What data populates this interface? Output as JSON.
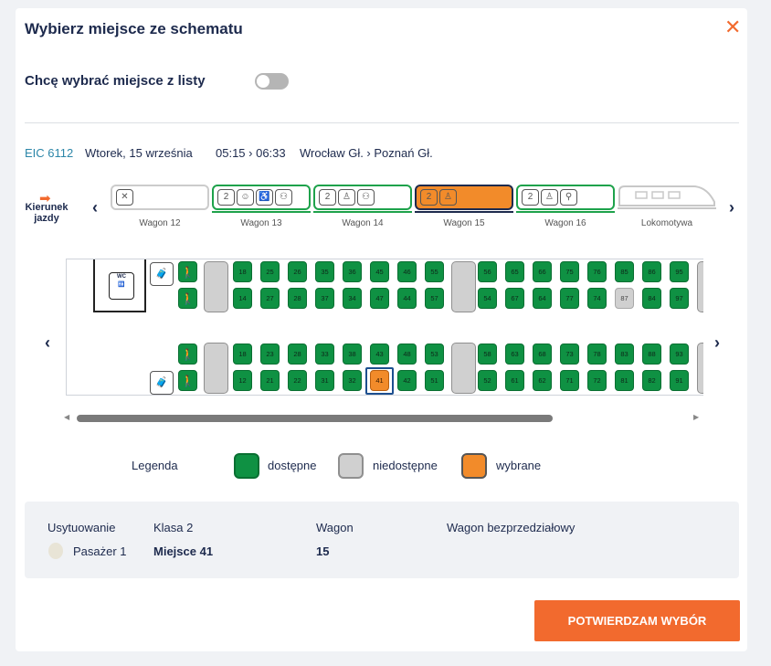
{
  "modal": {
    "title": "Wybierz miejsce ze schematu",
    "close_icon": "close-icon"
  },
  "toggle": {
    "label": "Chcę wybrać miejsce z listy",
    "state": "off"
  },
  "journey": {
    "train": "EIC 6112",
    "date": "Wtorek, 15 września",
    "time": "05:15 › 06:33",
    "route": "Wrocław Gł. › Poznań Gł."
  },
  "direction": {
    "label": "Kierunek jazdy"
  },
  "wagons": [
    {
      "label": "Wagon 12",
      "status": "unavailable",
      "icons": [
        "restaurant-icon"
      ]
    },
    {
      "label": "Wagon 13",
      "status": "available",
      "icons": [
        "class-2-icon",
        "child-icon",
        "wheelchair-icon",
        "carer-icon"
      ]
    },
    {
      "label": "Wagon 14",
      "status": "available",
      "icons": [
        "class-2-icon",
        "person-icon",
        "family-icon"
      ]
    },
    {
      "label": "Wagon 15",
      "status": "selected",
      "icons": [
        "class-2-icon",
        "person-icon"
      ]
    },
    {
      "label": "Wagon 16",
      "status": "available",
      "icons": [
        "class-2-icon",
        "person-icon",
        "bicycle-icon"
      ]
    },
    {
      "label": "Lokomotywa",
      "status": "locomotive",
      "icons": []
    }
  ],
  "seat_rows": {
    "top_window": [
      "18",
      "25",
      "26",
      "35",
      "36",
      "45",
      "46",
      "55",
      "56",
      "65",
      "66",
      "75",
      "76",
      "85",
      "86",
      "95"
    ],
    "top_aisle": [
      "14",
      "27",
      "28",
      "37",
      "34",
      "47",
      "44",
      "57",
      "54",
      "67",
      "64",
      "77",
      "74",
      "87",
      "84",
      "97"
    ],
    "bottom_aisle": [
      "18",
      "23",
      "28",
      "33",
      "38",
      "43",
      "48",
      "53",
      "58",
      "63",
      "68",
      "73",
      "78",
      "83",
      "88",
      "93"
    ],
    "bottom_window": [
      "12",
      "21",
      "22",
      "31",
      "32",
      "41",
      "42",
      "51",
      "52",
      "61",
      "62",
      "71",
      "72",
      "81",
      "82",
      "91"
    ]
  },
  "unavailable_seats": [
    "87"
  ],
  "selected_seat": "41",
  "wc_label": "WC",
  "legend": {
    "title": "Legenda",
    "available": "dostępne",
    "unavailable": "niedostępne",
    "selected": "wybrane"
  },
  "colors": {
    "accent": "#f26a2e",
    "available": "#0f9143",
    "unavailable": "#d0d0d0",
    "selected": "#f28b2a"
  },
  "summary": {
    "h_placement": "Usytuowanie",
    "h_class": "Klasa 2",
    "h_wagon": "Wagon",
    "h_type": "Wagon bezprzedziałowy",
    "passenger": "Pasażer 1",
    "seat": "Miejsce 41",
    "wagon": "15"
  },
  "confirm_button": "POTWIERDZAM WYBÓR"
}
